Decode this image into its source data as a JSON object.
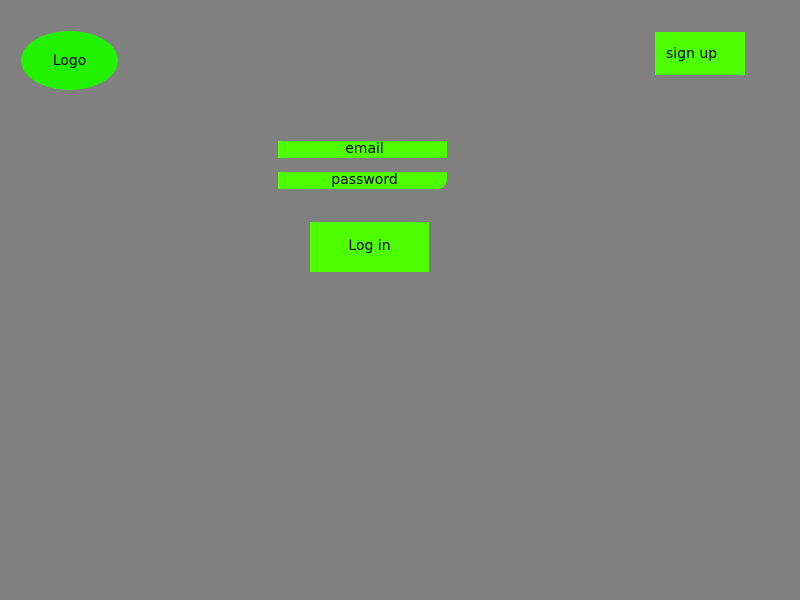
{
  "colors": {
    "background": "#808080",
    "logo": "#22f200",
    "accent": "#4dff00",
    "text": "#000000"
  },
  "header": {
    "logo_label": "Logo",
    "signup_label": "sign up"
  },
  "login_form": {
    "email_label": "email",
    "password_label": "password",
    "login_label": "Log in"
  }
}
